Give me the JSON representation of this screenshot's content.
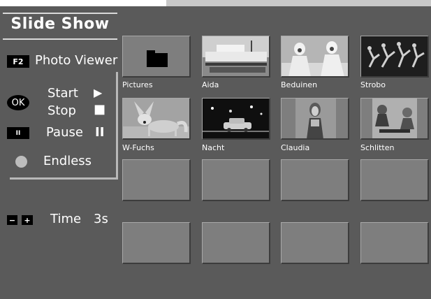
{
  "title": "Slide Show",
  "photo_viewer": {
    "key": "F2",
    "label": "Photo Viewer"
  },
  "controls": {
    "ok_key": "OK",
    "start_label": "Start",
    "start_symbol": "▶",
    "stop_label": "Stop",
    "stop_symbol": "■",
    "pause_key": "II",
    "pause_label": "Pause",
    "pause_symbol": "II",
    "endless_label": "Endless"
  },
  "time": {
    "minus_key": "−",
    "plus_key": "+",
    "label": "Time",
    "value": "3s"
  },
  "thumbnails": [
    {
      "caption": "Pictures",
      "icon": "folder-icon"
    },
    {
      "caption": "Aida",
      "icon": "ship-photo"
    },
    {
      "caption": "Beduinen",
      "icon": "bedouins-photo"
    },
    {
      "caption": "Strobo",
      "icon": "strobe-dancer-photo"
    },
    {
      "caption": "W-Fuchs",
      "icon": "fox-photo"
    },
    {
      "caption": "Nacht",
      "icon": "night-car-photo"
    },
    {
      "caption": "Claudia",
      "icon": "woman-portrait-photo"
    },
    {
      "caption": "Schlitten",
      "icon": "sled-photo"
    }
  ]
}
